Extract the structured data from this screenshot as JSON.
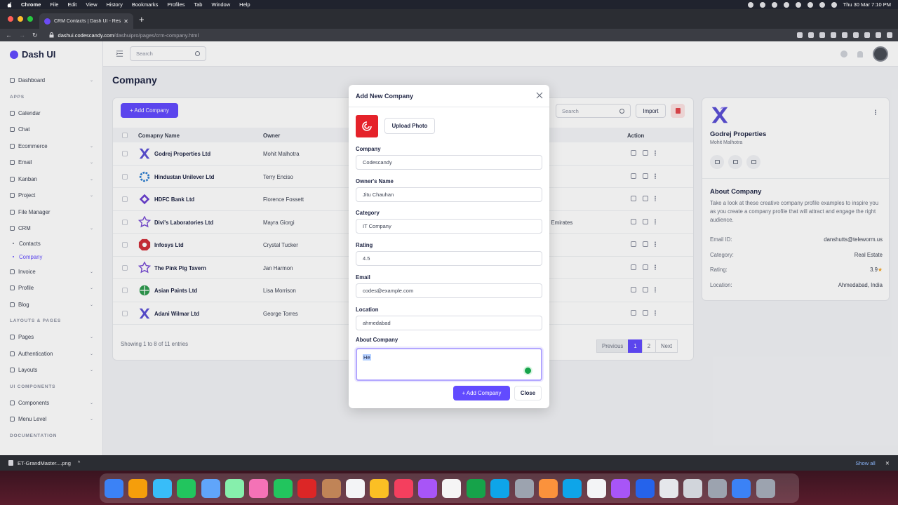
{
  "os_menubar": {
    "items": [
      "Chrome",
      "File",
      "Edit",
      "View",
      "History",
      "Bookmarks",
      "Profiles",
      "Tab",
      "Window",
      "Help"
    ],
    "datetime": "Thu 30 Mar  7:10 PM"
  },
  "browser": {
    "tab_title": "CRM Contacts | Dash UI - Res",
    "url_domain": "dashui.codescandy.com",
    "url_path": "/dashuipro/pages/crm-company.html"
  },
  "sidebar": {
    "brand": "Dash UI",
    "items": [
      {
        "type": "item",
        "label": "Dashboard",
        "chevron": true
      },
      {
        "type": "section",
        "label": "APPS"
      },
      {
        "type": "item",
        "label": "Calendar",
        "chevron": false
      },
      {
        "type": "item",
        "label": "Chat",
        "chevron": false
      },
      {
        "type": "item",
        "label": "Ecommerce",
        "chevron": true
      },
      {
        "type": "item",
        "label": "Email",
        "chevron": true
      },
      {
        "type": "item",
        "label": "Kanban",
        "chevron": true
      },
      {
        "type": "item",
        "label": "Project",
        "chevron": true
      },
      {
        "type": "item",
        "label": "File Manager",
        "chevron": false
      },
      {
        "type": "item",
        "label": "CRM",
        "chevron": true
      },
      {
        "type": "sub",
        "label": "Contacts",
        "active": false
      },
      {
        "type": "sub",
        "label": "Company",
        "active": true
      },
      {
        "type": "item",
        "label": "Invoice",
        "chevron": true
      },
      {
        "type": "item",
        "label": "Profile",
        "chevron": true
      },
      {
        "type": "item",
        "label": "Blog",
        "chevron": true
      },
      {
        "type": "section",
        "label": "LAYOUTS & PAGES"
      },
      {
        "type": "item",
        "label": "Pages",
        "chevron": true
      },
      {
        "type": "item",
        "label": "Authentication",
        "chevron": true
      },
      {
        "type": "item",
        "label": "Layouts",
        "chevron": true
      },
      {
        "type": "section",
        "label": "UI COMPONENTS"
      },
      {
        "type": "item",
        "label": "Components",
        "chevron": true
      },
      {
        "type": "item",
        "label": "Menu Level",
        "chevron": true
      },
      {
        "type": "section",
        "label": "DOCUMENTATION"
      }
    ]
  },
  "header": {
    "search_placeholder": "Search"
  },
  "page": {
    "title": "Company",
    "add_button": "+ Add Company",
    "search_placeholder": "Search",
    "import_button": "Import",
    "columns": {
      "company": "Comapny Name",
      "owner": "Owner",
      "action": "Action"
    },
    "rows": [
      {
        "company": "Godrej Properties Ltd",
        "owner": "Mohit Malhotra",
        "extra": "s",
        "logo": "x",
        "color": "#5b4fd6"
      },
      {
        "company": "Hindustan Unilever Ltd",
        "owner": "Terry Enciso",
        "extra": "",
        "logo": "gear",
        "color": "#2f7fd1"
      },
      {
        "company": "HDFC Bank Ltd",
        "owner": "Florence Fossett",
        "extra": "",
        "logo": "diamond",
        "color": "#6a3fd1"
      },
      {
        "company": "Divi's Laboratories Ltd",
        "owner": "Mayra Giorgi",
        "extra": "b Emirates",
        "logo": "star",
        "color": "#7b4fd6"
      },
      {
        "company": "Infosys Ltd",
        "owner": "Crystal Tucker",
        "extra": "",
        "logo": "oct",
        "color": "#d12f3a"
      },
      {
        "company": "The Pink Pig Tavern",
        "owner": "Jan Harmon",
        "extra": "",
        "logo": "star",
        "color": "#7b4fd6"
      },
      {
        "company": "Asian Paints Ltd",
        "owner": "Lisa Morrison",
        "extra": "e",
        "logo": "circle",
        "color": "#2f9b4f"
      },
      {
        "company": "Adani Wilmar Ltd",
        "owner": "George Torres",
        "extra": "",
        "logo": "x",
        "color": "#5b4fd6"
      }
    ],
    "showing": "Showing 1 to 8 of 11 entries",
    "pagination": [
      "Previous",
      "1",
      "2",
      "Next"
    ]
  },
  "profile": {
    "name": "Godrej Properties",
    "owner": "Mohit Malhotra",
    "about_heading": "About Company",
    "about_text": "Take a look at these creative company profile examples to inspire you as you create a company profile that will attract and engage the right audience.",
    "details": [
      {
        "key": "Email ID:",
        "value": "danshutts@teleworm.us"
      },
      {
        "key": "Category:",
        "value": "Real Estate"
      },
      {
        "key": "Rating:",
        "value": "3.9"
      },
      {
        "key": "Location:",
        "value": "Ahmedabad, India"
      }
    ],
    "star": "★"
  },
  "modal": {
    "title": "Add New Company",
    "upload_button": "Upload Photo",
    "fields": [
      {
        "label": "Company",
        "value": "Codescandy"
      },
      {
        "label": "Owner's Name",
        "value": "Jitu Chauhan"
      },
      {
        "label": "Category",
        "value": "IT Company"
      },
      {
        "label": "Rating",
        "value": "4.5"
      },
      {
        "label": "Email",
        "value": "codes@example.com"
      },
      {
        "label": "Location",
        "value": "ahmedabad"
      }
    ],
    "about_label": "About Company",
    "about_value": "He",
    "submit_button": "+ Add Company",
    "close_button": "Close"
  },
  "downloads": {
    "file": "ET-GrandMaster....png",
    "show_all": "Show all"
  },
  "dock_colors": [
    "#3b82f6",
    "#f59e0b",
    "#38bdf8",
    "#22c55e",
    "#60a5fa",
    "#86efac",
    "#f472b6",
    "#22c55e",
    "#dc2626",
    "#c08457",
    "#f3f4f6",
    "#fbbf24",
    "#f43f5e",
    "#a855f7",
    "#f5f5f5",
    "#16a34a",
    "#0ea5e9",
    "#9ca3af",
    "#fb923c",
    "#0ea5e9",
    "#f3f4f6",
    "#a855f7",
    "#2563eb",
    "#e5e7eb",
    "#d1d5db",
    "#9ca3af",
    "#3b82f6",
    "#9ca3af"
  ]
}
